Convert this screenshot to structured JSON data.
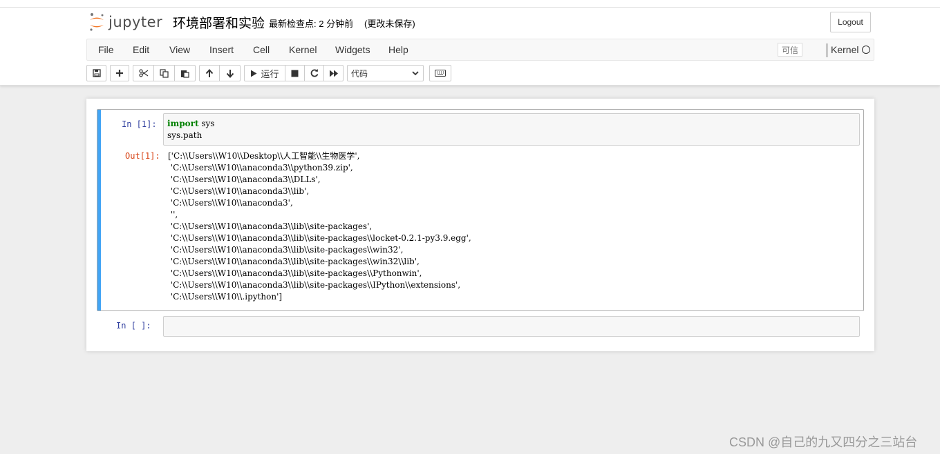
{
  "header": {
    "logo_text": "jupyter",
    "notebook_title": "环境部署和实验",
    "checkpoint": "最新检查点: 2 分钟前",
    "unsaved": "(更改未保存)",
    "logout_label": "Logout"
  },
  "menubar": {
    "items": [
      "File",
      "Edit",
      "View",
      "Insert",
      "Cell",
      "Kernel",
      "Widgets",
      "Help"
    ],
    "trusted": "可信",
    "kernel_name": "Kernel"
  },
  "toolbar": {
    "run_label": "运行",
    "cell_type": "代码"
  },
  "cells": [
    {
      "in_prompt": "In  [1]:",
      "code_keyword": "import",
      "code_line1_rest": " sys",
      "code_line2": "sys.path",
      "out_prompt": "Out[1]:",
      "output": [
        "['C:\\\\Users\\\\W10\\\\Desktop\\\\人工智能\\\\生物医学',",
        " 'C:\\\\Users\\\\W10\\\\anaconda3\\\\python39.zip',",
        " 'C:\\\\Users\\\\W10\\\\anaconda3\\\\DLLs',",
        " 'C:\\\\Users\\\\W10\\\\anaconda3\\\\lib',",
        " 'C:\\\\Users\\\\W10\\\\anaconda3',",
        " '',",
        " 'C:\\\\Users\\\\W10\\\\anaconda3\\\\lib\\\\site-packages',",
        " 'C:\\\\Users\\\\W10\\\\anaconda3\\\\lib\\\\site-packages\\\\locket-0.2.1-py3.9.egg',",
        " 'C:\\\\Users\\\\W10\\\\anaconda3\\\\lib\\\\site-packages\\\\win32',",
        " 'C:\\\\Users\\\\W10\\\\anaconda3\\\\lib\\\\site-packages\\\\win32\\\\lib',",
        " 'C:\\\\Users\\\\W10\\\\anaconda3\\\\lib\\\\site-packages\\\\Pythonwin',",
        " 'C:\\\\Users\\\\W10\\\\anaconda3\\\\lib\\\\site-packages\\\\IPython\\\\extensions',",
        " 'C:\\\\Users\\\\W10\\\\.ipython']"
      ]
    },
    {
      "in_prompt": "In  [ ]:"
    }
  ],
  "watermark": "CSDN @自己的九又四分之三站台",
  "colors": {
    "selected_cell_bar": "#42a5f5",
    "in_prompt": "#303f9f",
    "out_prompt": "#d84315",
    "keyword": "#008000"
  }
}
